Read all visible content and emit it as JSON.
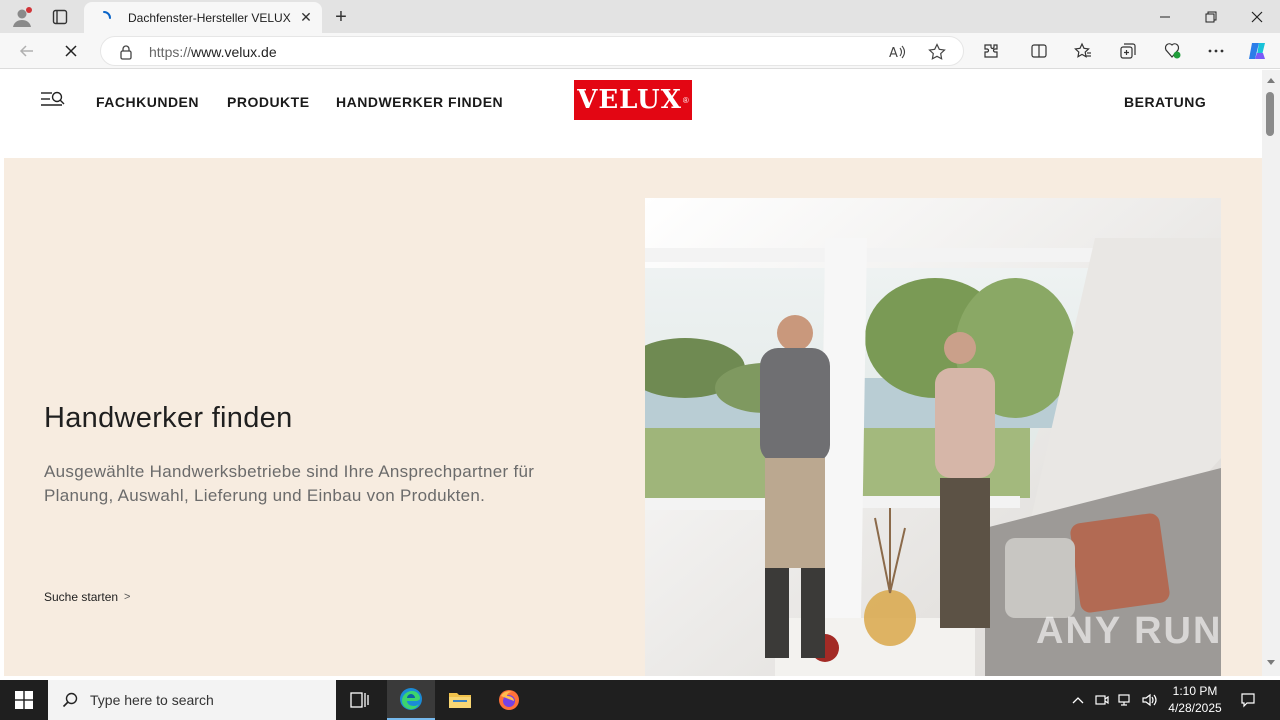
{
  "browser": {
    "tab_title": "Dachfenster-Hersteller VELUX",
    "url_proto": "https://",
    "url_host": "www.velux.de"
  },
  "site": {
    "nav": [
      "FACHKUNDEN",
      "PRODUKTE",
      "HANDWERKER FINDEN"
    ],
    "logo_text": "VELUX",
    "logo_mark": "®",
    "cta": "BERATUNG"
  },
  "hero": {
    "title": "Handwerker finden",
    "text": "Ausgewählte Handwerksbetriebe sind Ihre Ansprechpartner für Planung, Auswahl, Lieferung und Einbau von Produkten.",
    "link": "Suche starten",
    "link_chevron": ">"
  },
  "watermark": "ANY RUN",
  "taskbar": {
    "search_placeholder": "Type here to search",
    "time": "1:10 PM",
    "date": "4/28/2025"
  },
  "colors": {
    "brand": "#e30613",
    "hero_bg": "#f7ece0"
  }
}
